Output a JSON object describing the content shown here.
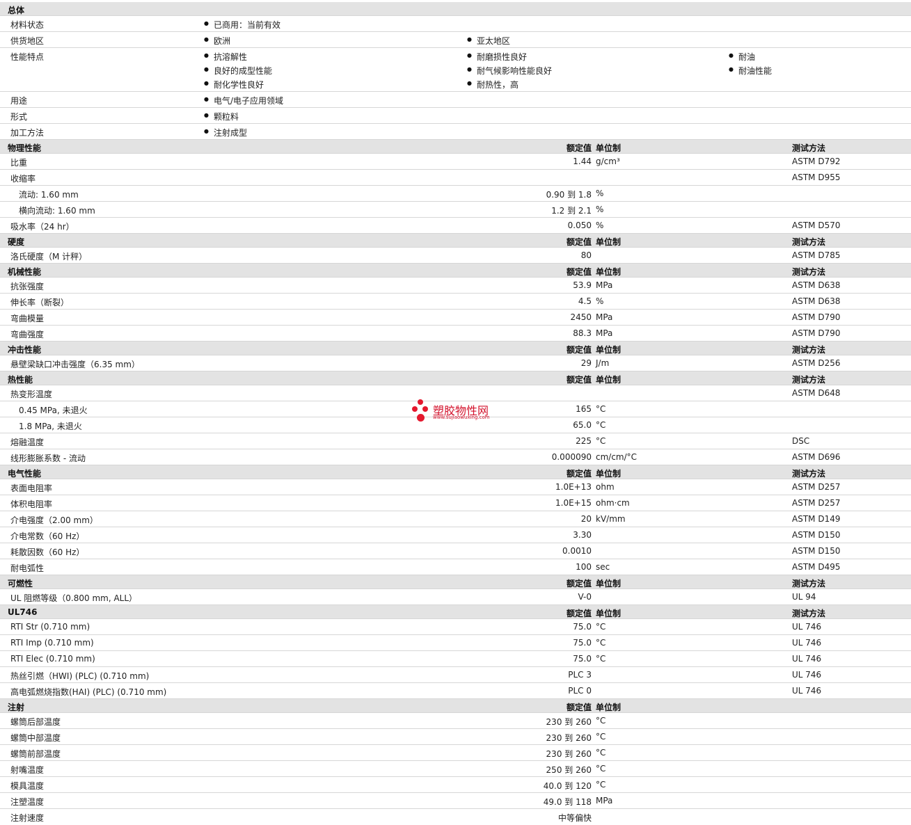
{
  "general": {
    "header": "总体",
    "rows": [
      {
        "label": "材料状态",
        "items": [
          "已商用：当前有效"
        ]
      },
      {
        "label": "供货地区",
        "items": [
          "欧洲",
          "亚太地区"
        ]
      },
      {
        "label": "性能特点",
        "items": [
          "抗溶解性",
          "耐磨损性良好",
          "耐油",
          "良好的成型性能",
          "耐气候影响性能良好",
          "耐油性能",
          "耐化学性良好",
          "耐热性，高"
        ]
      },
      {
        "label": "用途",
        "items": [
          "电气/电子应用领域"
        ]
      },
      {
        "label": "形式",
        "items": [
          "颗粒料"
        ]
      },
      {
        "label": "加工方法",
        "items": [
          "注射成型"
        ]
      }
    ]
  },
  "col_headers": {
    "value": "额定值",
    "unit": "单位制",
    "method": "测试方法"
  },
  "physical": {
    "header": "物理性能",
    "rows": [
      {
        "label": "比重",
        "value": "1.44",
        "unit": "g/cm³",
        "method": "ASTM D792"
      },
      {
        "label": "收缩率",
        "value": "",
        "unit": "",
        "method": "ASTM D955"
      },
      {
        "label": "流动: 1.60 mm",
        "value": "0.90 到  1.8",
        "unit": "%",
        "method": ""
      },
      {
        "label": "横向流动: 1.60 mm",
        "value": "1.2 到  2.1",
        "unit": "%",
        "method": ""
      },
      {
        "label": "吸水率（24 hr）",
        "value": "0.050",
        "unit": "%",
        "method": "ASTM D570"
      }
    ]
  },
  "hardness": {
    "header": "硬度",
    "rows": [
      {
        "label": "洛氏硬度（M 计秤）",
        "value": "80",
        "unit": "",
        "method": "ASTM D785"
      }
    ]
  },
  "mechanical": {
    "header": "机械性能",
    "rows": [
      {
        "label": "抗张强度",
        "value": "53.9",
        "unit": "MPa",
        "method": "ASTM D638"
      },
      {
        "label": "伸长率（断裂）",
        "value": "4.5",
        "unit": "%",
        "method": "ASTM D638"
      },
      {
        "label": "弯曲模量",
        "value": "2450",
        "unit": "MPa",
        "method": "ASTM D790"
      },
      {
        "label": "弯曲强度",
        "value": "88.3",
        "unit": "MPa",
        "method": "ASTM D790"
      }
    ]
  },
  "impact": {
    "header": "冲击性能",
    "rows": [
      {
        "label": "悬壁梁缺口冲击强度（6.35 mm）",
        "value": "29",
        "unit": "J/m",
        "method": "ASTM D256"
      }
    ]
  },
  "thermal": {
    "header": "热性能",
    "rows": [
      {
        "label": "热变形温度",
        "value": "",
        "unit": "",
        "method": "ASTM D648"
      },
      {
        "label": "0.45 MPa, 未退火",
        "value": "165",
        "unit": "°C",
        "method": ""
      },
      {
        "label": "1.8 MPa, 未退火",
        "value": "65.0",
        "unit": "°C",
        "method": ""
      },
      {
        "label": "熔融温度",
        "value": "225",
        "unit": "°C",
        "method": "DSC"
      },
      {
        "label": "线形膨胀系数  - 流动",
        "value": "0.000090",
        "unit": "cm/cm/°C",
        "method": "ASTM D696"
      }
    ]
  },
  "electrical": {
    "header": "电气性能",
    "rows": [
      {
        "label": "表面电阻率",
        "value": "1.0E+13",
        "unit": "ohm",
        "method": "ASTM D257"
      },
      {
        "label": "体积电阻率",
        "value": "1.0E+15",
        "unit": "ohm·cm",
        "method": "ASTM D257"
      },
      {
        "label": "介电强度（2.00 mm）",
        "value": "20",
        "unit": "kV/mm",
        "method": "ASTM D149"
      },
      {
        "label": "介电常数（60 Hz）",
        "value": "3.30",
        "unit": "",
        "method": "ASTM D150"
      },
      {
        "label": "耗散因数（60 Hz）",
        "value": "0.0010",
        "unit": "",
        "method": "ASTM D150"
      },
      {
        "label": "耐电弧性",
        "value": "100",
        "unit": "sec",
        "method": "ASTM D495"
      }
    ]
  },
  "flammability": {
    "header": "可燃性",
    "rows": [
      {
        "label": "UL 阻燃等级（0.800 mm, ALL）",
        "value": "V-0",
        "unit": "",
        "method": "UL 94"
      }
    ]
  },
  "ul746": {
    "header": "UL746",
    "rows": [
      {
        "label": "RTI Str (0.710 mm)",
        "value": "75.0",
        "unit": "°C",
        "method": "UL 746"
      },
      {
        "label": "RTI Imp (0.710 mm)",
        "value": "75.0",
        "unit": "°C",
        "method": "UL 746"
      },
      {
        "label": "RTI Elec (0.710 mm)",
        "value": "75.0",
        "unit": "°C",
        "method": "UL 746"
      },
      {
        "label": "热丝引燃（HWI) (PLC) (0.710 mm)",
        "value": "PLC 3",
        "unit": "",
        "method": "UL 746"
      },
      {
        "label": "高电弧燃烧指数(HAI) (PLC) (0.710 mm)",
        "value": "PLC 0",
        "unit": "",
        "method": "UL 746"
      }
    ]
  },
  "injection": {
    "header": "注射",
    "rows": [
      {
        "label": "螺筒后部温度",
        "value": "230 到  260",
        "unit": "°C",
        "method": ""
      },
      {
        "label": "螺筒中部温度",
        "value": "230 到  260",
        "unit": "°C",
        "method": ""
      },
      {
        "label": "螺筒前部温度",
        "value": "230 到  260",
        "unit": "°C",
        "method": ""
      },
      {
        "label": "射嘴温度",
        "value": "250 到  260",
        "unit": "°C",
        "method": ""
      },
      {
        "label": "模具温度",
        "value": "40.0 到  120",
        "unit": "°C",
        "method": ""
      },
      {
        "label": "注塑温度",
        "value": "49.0 到  118",
        "unit": "MPa",
        "method": ""
      },
      {
        "label": "注射速度",
        "value": "中等偏快",
        "unit": "",
        "method": ""
      }
    ]
  },
  "watermark": {
    "text": "塑胶物性网",
    "url": "www.sujiaowuxing.com"
  }
}
